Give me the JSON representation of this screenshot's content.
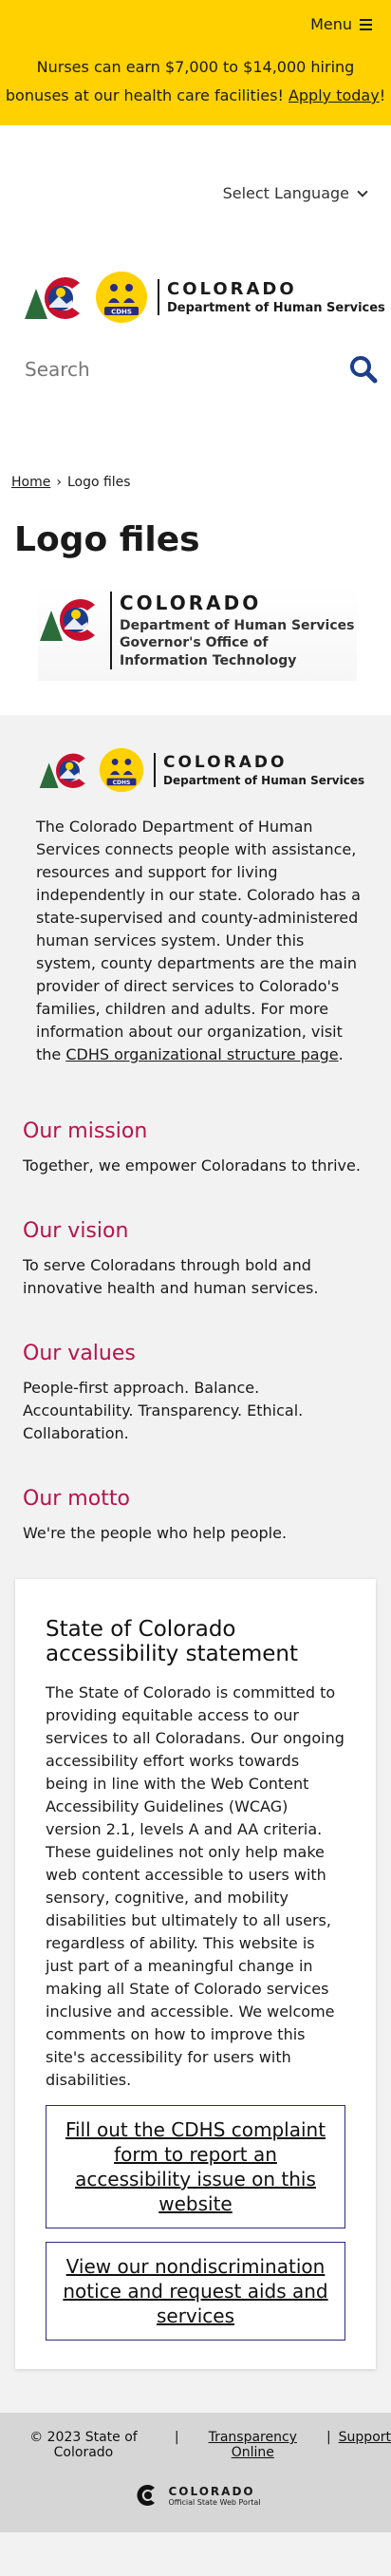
{
  "banner": {
    "menu_label": "Menu",
    "message_before": "Nurses can earn $7,000 to $14,000 hiring bonuses at our health care facilities! ",
    "message_link": "Apply today",
    "message_after": "!",
    "bg_color": "#ffd100"
  },
  "header": {
    "language_label": "Select Language",
    "logo_title": "COLORADO",
    "logo_subtitle": "Department of Human Services",
    "badge_text": "CDHS",
    "search_placeholder": "Search"
  },
  "breadcrumb": {
    "home": "Home",
    "separator": "›",
    "current": "Logo files"
  },
  "page_title": "Logo files",
  "title_graphic": {
    "line1": "COLORADO",
    "line2": "Department of Human Services",
    "line3a": "Governor's Office of",
    "line3b": "Information Technology"
  },
  "grey_logo": {
    "title": "COLORADO",
    "subtitle": "Department of Human Services",
    "badge_text": "CDHS"
  },
  "intro": {
    "text": "The Colorado Department of Human Services connects people with assistance, resources and support for living independently in our state. Colorado has a state-supervised and county-administered human services system. Under this system, county departments are the main provider of direct services to Colorado's families, children and adults. For more information about our organization, visit the ",
    "link": "CDHS organizational structure page",
    "end": "."
  },
  "sections": {
    "mission": {
      "heading": "Our mission",
      "text": "Together, we empower Coloradans to thrive."
    },
    "vision": {
      "heading": "Our vision",
      "text": "To serve Coloradans through bold and innovative health and human services."
    },
    "values": {
      "heading": "Our values",
      "text": "People-first approach. Balance. Accountability. Transparency. Ethical. Collaboration."
    },
    "motto": {
      "heading": "Our motto",
      "text": "We're the people who help people."
    }
  },
  "accessibility": {
    "heading": "State of Colorado accessibility statement",
    "body": "The State of Colorado is committed to providing equitable access to our services to all Coloradans. Our ongoing accessibility effort works towards being in line with the Web Content Accessibility Guidelines (WCAG) version 2.1, levels A and AA criteria. These guidelines not only help make web content accessible to users with sensory, cognitive, and mobility disabilities but ultimately to all users, regardless of ability. This website is just part of a meaningful change in making all State of Colorado services inclusive and accessible. We welcome comments on how to improve this site's accessibility for users with disabilities.",
    "button1": "Fill out the CDHS complaint form to report an accessibility issue on this website",
    "button2": "View our nondiscrimination notice and request aids and services"
  },
  "footer": {
    "copyright": "© 2023 State of Colorado",
    "sep": "|",
    "link1": "Transparency Online",
    "link2": "Support",
    "portal_title": "COLORADO",
    "portal_subtitle": "Official State Web Portal"
  },
  "colors": {
    "accent_heading": "#b7134a",
    "button_border": "#2a2a80",
    "search_icon": "#1c3d8c"
  }
}
